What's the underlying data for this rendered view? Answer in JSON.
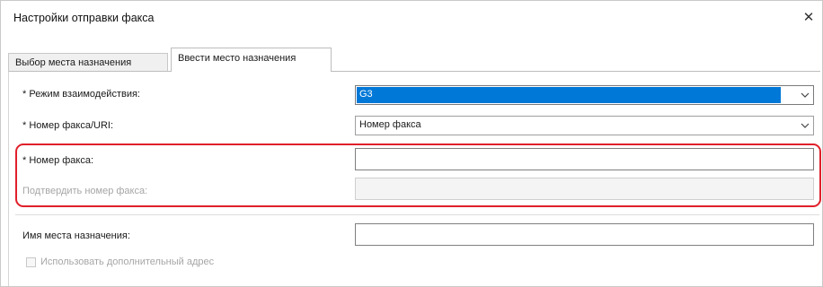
{
  "window": {
    "title": "Настройки отправки факса",
    "close_glyph": "✕"
  },
  "tabs": [
    {
      "label": "Выбор места назначения",
      "active": false
    },
    {
      "label": "Ввести место назначения",
      "active": true
    }
  ],
  "form": {
    "mode": {
      "label": "* Режим взаимодействия:",
      "value": "G3"
    },
    "fax_uri": {
      "label": "* Номер факса/URI:",
      "value": "Номер факса"
    },
    "fax_number": {
      "label": "* Номер факса:",
      "value": ""
    },
    "confirm_fax_number": {
      "label": "Подтвердить номер факса:",
      "value": ""
    },
    "destination_name": {
      "label": "Имя места назначения:",
      "value": ""
    },
    "additional_address": {
      "label": "Использовать дополнительный адрес",
      "checked": false
    }
  },
  "colors": {
    "highlight": "#e0202a",
    "selection": "#0078d7"
  },
  "icons": {
    "close": "close-icon",
    "dropdown": "chevron-down-icon"
  }
}
